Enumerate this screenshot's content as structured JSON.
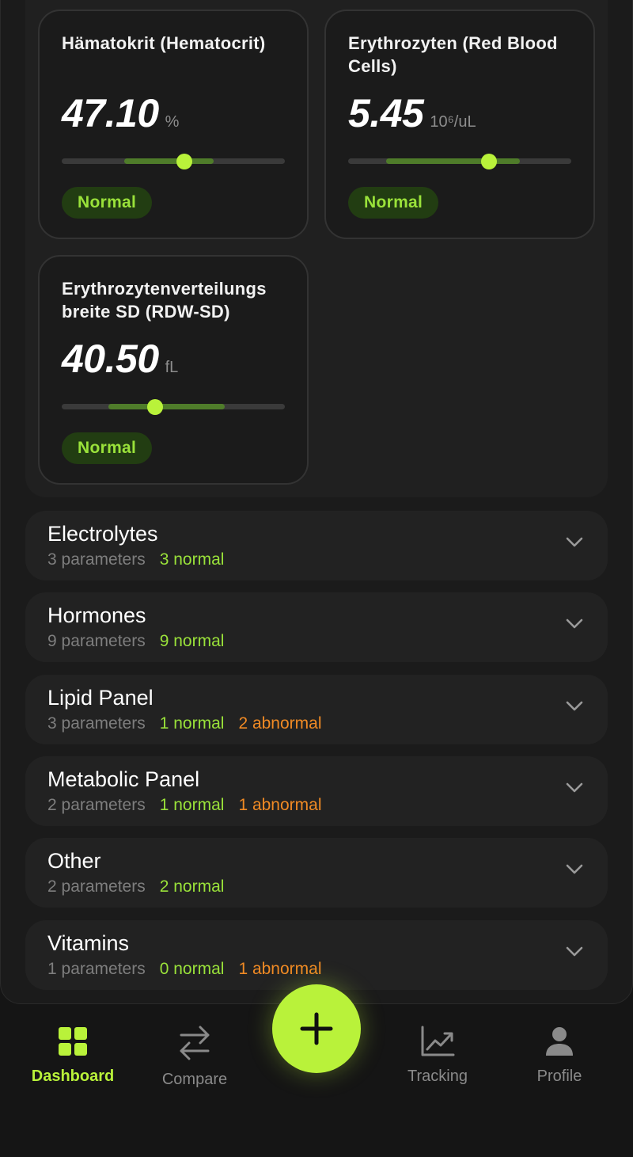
{
  "cards": [
    {
      "title": "Hämatokrit (Hematocrit)",
      "value": "47.10",
      "unit": "%",
      "status": "Normal",
      "normal_range_fraction": [
        0.28,
        0.68
      ],
      "marker_fraction": 0.55
    },
    {
      "title": "Erythrozyten (Red Blood Cells)",
      "value": "5.45",
      "unit": "10⁶/uL",
      "status": "Normal",
      "normal_range_fraction": [
        0.17,
        0.77
      ],
      "marker_fraction": 0.63
    },
    {
      "title": "Erythrozytenverteilungs breite SD (RDW-SD)",
      "value": "40.50",
      "unit": "fL",
      "status": "Normal",
      "normal_range_fraction": [
        0.21,
        0.73
      ],
      "marker_fraction": 0.42
    }
  ],
  "groups": [
    {
      "name": "Electrolytes",
      "params": "3 parameters",
      "normal": "3 normal",
      "abnormal": ""
    },
    {
      "name": "Hormones",
      "params": "9 parameters",
      "normal": "9 normal",
      "abnormal": ""
    },
    {
      "name": "Lipid Panel",
      "params": "3 parameters",
      "normal": "1 normal",
      "abnormal": "2 abnormal"
    },
    {
      "name": "Metabolic Panel",
      "params": "2 parameters",
      "normal": "1 normal",
      "abnormal": "1 abnormal"
    },
    {
      "name": "Other",
      "params": "2 parameters",
      "normal": "2 normal",
      "abnormal": ""
    },
    {
      "name": "Vitamins",
      "params": "1 parameters",
      "normal": "0 normal",
      "abnormal": "1 abnormal"
    }
  ],
  "nav": {
    "dashboard": "Dashboard",
    "compare": "Compare",
    "tracking": "Tracking",
    "profile": "Profile",
    "active": "dashboard"
  },
  "colors": {
    "accent": "#b9f23a",
    "normal_text": "#9ae23a",
    "abnormal_text": "#f08a24",
    "badge_bg": "#223d12",
    "range_fill": "#4f7c2a"
  },
  "icons": {
    "fab": "plus-icon",
    "dashboard": "grid-icon",
    "compare": "swap-arrows-icon",
    "tracking": "trend-chart-icon",
    "profile": "person-icon",
    "group_toggle": "chevron-down-icon"
  }
}
